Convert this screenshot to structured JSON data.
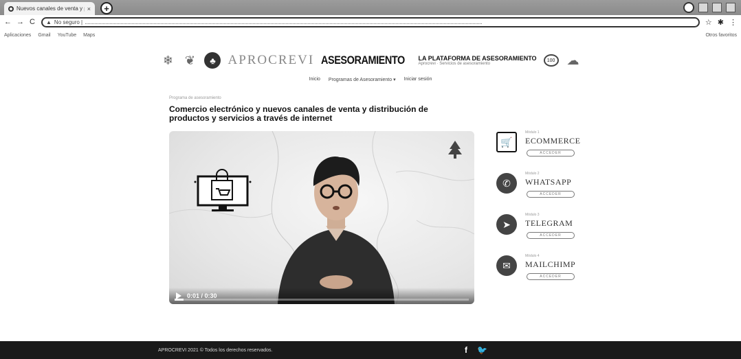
{
  "browser": {
    "tab_title": "Nuevos canales de venta y pro...",
    "tab_close": "×",
    "new_tab": "+",
    "nav_back": "←",
    "nav_forward": "→",
    "nav_reload": "C",
    "address_prefix": "No seguro |",
    "bookmarks": [
      "Aplicaciones",
      "Gmail",
      "YouTube",
      "Maps"
    ],
    "bookmarks_right": "Otros favoritos"
  },
  "brand": {
    "name": "APROCREVI",
    "sub": "ASESORAMIENTO",
    "tagline": "LA PLATAFORMA DE ASESORAMIENTO",
    "tagline_sub": "Aprocrevi · Servicios de asesoramiento",
    "badge": "100"
  },
  "nav": {
    "items": [
      "Inicio",
      "Programas de Asesoramiento ▾",
      "Iniciar sesión"
    ]
  },
  "content": {
    "breadcrumb": "Programa de asesoramiento",
    "title": "Comercio electrónico y nuevos canales de venta y distribución de productos y servicios a través de internet"
  },
  "video": {
    "time": "0:01 / 0:30",
    "progress_fraction": 0.03
  },
  "modules": [
    {
      "label": "Módulo 1",
      "name": "ECOMMERCE",
      "button": "ACCEDER",
      "icon": "shop-monitor-icon",
      "glyph": "🛒"
    },
    {
      "label": "Módulo 2",
      "name": "WHATSAPP",
      "button": "ACCEDER",
      "icon": "whatsapp-icon",
      "glyph": "✆"
    },
    {
      "label": "Módulo 3",
      "name": "TELEGRAM",
      "button": "ACCEDER",
      "icon": "telegram-icon",
      "glyph": "➤"
    },
    {
      "label": "Módulo 4",
      "name": "MAILCHIMP",
      "button": "ACCEDER",
      "icon": "mailchimp-icon",
      "glyph": "✉"
    }
  ],
  "footer": {
    "copyright": "APROCREVI 2021 © Todos los derechos reservados.",
    "facebook": "f",
    "twitter": "🐦"
  }
}
